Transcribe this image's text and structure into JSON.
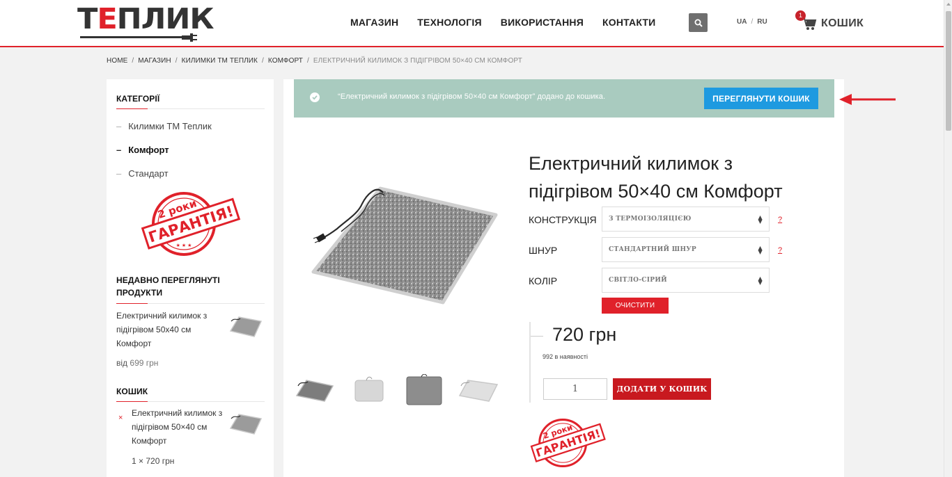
{
  "header": {
    "logo_left": "Т",
    "logo_mid": "Е",
    "logo_right": "ПЛИК",
    "nav": [
      "МАГАЗИН",
      "ТЕХНОЛОГІЯ",
      "ВИКОРИСТАННЯ",
      "КОНТАКТИ"
    ],
    "lang_ua": "UA",
    "lang_sep": "/",
    "lang_ru": "RU",
    "cart_count": "1",
    "cart_label": "КОШИК",
    "search_icon": "search-icon",
    "cart_icon": "cart-icon"
  },
  "breadcrumb": {
    "items": [
      "HOME",
      "МАГАЗИН",
      "КИЛИМКИ ТМ ТЕПЛИК",
      "КОМФОРТ"
    ],
    "separator": "/",
    "current": "ЕЛЕКТРИЧНИЙ КИЛИМОК З ПІДІГРІВОМ 50×40 СМ КОМФОРТ"
  },
  "sidebar": {
    "categories_title": "КАТЕГОРІЇ",
    "categories": [
      {
        "label": "Килимки ТМ Теплик",
        "active": false
      },
      {
        "label": "Комфорт",
        "active": true
      },
      {
        "label": "Стандарт",
        "active": false
      }
    ],
    "dash": "–",
    "stamp_line1": "2 роки",
    "stamp_line2": "ГАРАНТІЯ!",
    "recent_title": "НЕДАВНО ПЕРЕГЛЯНУТІ ПРОДУКТИ",
    "recent_item": "Електричний килимок з підігрівом 50х40 см Комфорт",
    "recent_price_prefix": "від",
    "recent_price": "699 грн",
    "cart_title": "КОШИК",
    "cart_remove": "×",
    "cart_item": "Електричний килимок з підігрівом 50×40 см Комфорт",
    "cart_qty": "1 × 720 грн"
  },
  "notice": {
    "text": "“Електричний килимок з підігрівом 50×40 см Комфорт” додано до кошика.",
    "button": "ПЕРЕГЛЯНУТИ КОШИК",
    "color": "#a9cbbf"
  },
  "product": {
    "title": "Електричний килимок з підігрівом 50×40 см Комфорт",
    "options": [
      {
        "label": "КОНСТРУКЦІЯ",
        "value": "з термоізоляцією",
        "help": "?"
      },
      {
        "label": "ШНУР",
        "value": "стандартний шнур",
        "help": "?"
      },
      {
        "label": "КОЛІР",
        "value": "світло-сірий",
        "help": ""
      }
    ],
    "clear_label": "ОЧИСТИТИ",
    "price": "720 грн",
    "stock": "992 в наявності",
    "qty": "1",
    "add_to_cart": "ДОДАТИ У КОШИК",
    "stamp_line1": "2 роки",
    "stamp_line2": "ГАРАНТІЯ!"
  },
  "colors": {
    "accent_red": "#e0212a",
    "button_blue": "#1e9ae0",
    "add_btn_red": "#c8191f"
  }
}
